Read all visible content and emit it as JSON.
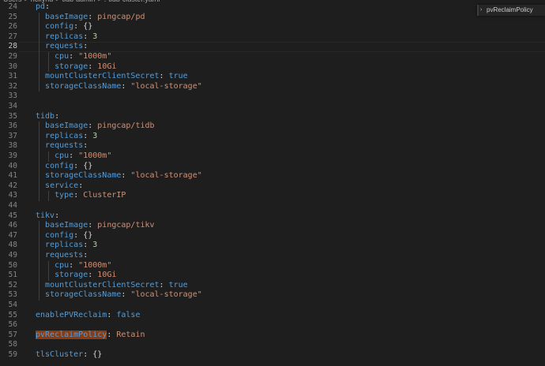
{
  "breadcrumb": [
    "Users",
    ">",
    "rickyhu",
    ">",
    "tidb-admin",
    ">",
    "!",
    "tidb-cluster.yaml"
  ],
  "find": {
    "value": "pvReclaimPolicy"
  },
  "lines": [
    {
      "n": "24",
      "tokens": [
        {
          "t": "pd",
          "c": "k"
        },
        {
          "t": ":",
          "c": "p"
        }
      ]
    },
    {
      "n": "25",
      "tokens": [
        {
          "t": "  "
        },
        {
          "t": "baseImage",
          "c": "k"
        },
        {
          "t": ": ",
          "c": "p"
        },
        {
          "t": "pingcap/pd",
          "c": "s"
        }
      ]
    },
    {
      "n": "26",
      "tokens": [
        {
          "t": "  "
        },
        {
          "t": "config",
          "c": "k"
        },
        {
          "t": ": ",
          "c": "p"
        },
        {
          "t": "{}",
          "c": "p"
        }
      ]
    },
    {
      "n": "27",
      "tokens": [
        {
          "t": "  "
        },
        {
          "t": "replicas",
          "c": "k"
        },
        {
          "t": ": ",
          "c": "p"
        },
        {
          "t": "3",
          "c": "n"
        }
      ]
    },
    {
      "n": "28",
      "tokens": [
        {
          "t": "  "
        },
        {
          "t": "requests",
          "c": "k"
        },
        {
          "t": ":",
          "c": "p"
        }
      ]
    },
    {
      "n": "29",
      "tokens": [
        {
          "t": "    "
        },
        {
          "t": "cpu",
          "c": "k"
        },
        {
          "t": ": ",
          "c": "p"
        },
        {
          "t": "\"1000m\"",
          "c": "s"
        }
      ]
    },
    {
      "n": "30",
      "tokens": [
        {
          "t": "    "
        },
        {
          "t": "storage",
          "c": "k"
        },
        {
          "t": ": ",
          "c": "p"
        },
        {
          "t": "10Gi",
          "c": "s"
        }
      ]
    },
    {
      "n": "31",
      "tokens": [
        {
          "t": "  "
        },
        {
          "t": "mountClusterClientSecret",
          "c": "k"
        },
        {
          "t": ": ",
          "c": "p"
        },
        {
          "t": "true",
          "c": "b"
        }
      ]
    },
    {
      "n": "32",
      "tokens": [
        {
          "t": "  "
        },
        {
          "t": "storageClassName",
          "c": "k"
        },
        {
          "t": ": ",
          "c": "p"
        },
        {
          "t": "\"local-storage\"",
          "c": "s"
        }
      ]
    },
    {
      "n": "33",
      "tokens": []
    },
    {
      "n": "34",
      "tokens": []
    },
    {
      "n": "35",
      "tokens": [
        {
          "t": "tidb",
          "c": "k"
        },
        {
          "t": ":",
          "c": "p"
        }
      ]
    },
    {
      "n": "36",
      "tokens": [
        {
          "t": "  "
        },
        {
          "t": "baseImage",
          "c": "k"
        },
        {
          "t": ": ",
          "c": "p"
        },
        {
          "t": "pingcap/tidb",
          "c": "s"
        }
      ]
    },
    {
      "n": "37",
      "tokens": [
        {
          "t": "  "
        },
        {
          "t": "replicas",
          "c": "k"
        },
        {
          "t": ": ",
          "c": "p"
        },
        {
          "t": "3",
          "c": "n"
        }
      ]
    },
    {
      "n": "38",
      "tokens": [
        {
          "t": "  "
        },
        {
          "t": "requests",
          "c": "k"
        },
        {
          "t": ":",
          "c": "p"
        }
      ]
    },
    {
      "n": "39",
      "tokens": [
        {
          "t": "    "
        },
        {
          "t": "cpu",
          "c": "k"
        },
        {
          "t": ": ",
          "c": "p"
        },
        {
          "t": "\"1000m\"",
          "c": "s"
        }
      ]
    },
    {
      "n": "40",
      "tokens": [
        {
          "t": "  "
        },
        {
          "t": "config",
          "c": "k"
        },
        {
          "t": ": ",
          "c": "p"
        },
        {
          "t": "{}",
          "c": "p"
        }
      ]
    },
    {
      "n": "41",
      "tokens": [
        {
          "t": "  "
        },
        {
          "t": "storageClassName",
          "c": "k"
        },
        {
          "t": ": ",
          "c": "p"
        },
        {
          "t": "\"local-storage\"",
          "c": "s"
        }
      ]
    },
    {
      "n": "42",
      "tokens": [
        {
          "t": "  "
        },
        {
          "t": "service",
          "c": "k"
        },
        {
          "t": ":",
          "c": "p"
        }
      ]
    },
    {
      "n": "43",
      "tokens": [
        {
          "t": "    "
        },
        {
          "t": "type",
          "c": "k"
        },
        {
          "t": ": ",
          "c": "p"
        },
        {
          "t": "ClusterIP",
          "c": "s"
        }
      ]
    },
    {
      "n": "44",
      "tokens": []
    },
    {
      "n": "45",
      "tokens": [
        {
          "t": "tikv",
          "c": "k"
        },
        {
          "t": ":",
          "c": "p"
        }
      ]
    },
    {
      "n": "46",
      "tokens": [
        {
          "t": "  "
        },
        {
          "t": "baseImage",
          "c": "k"
        },
        {
          "t": ": ",
          "c": "p"
        },
        {
          "t": "pingcap/tikv",
          "c": "s"
        }
      ]
    },
    {
      "n": "47",
      "tokens": [
        {
          "t": "  "
        },
        {
          "t": "config",
          "c": "k"
        },
        {
          "t": ": ",
          "c": "p"
        },
        {
          "t": "{}",
          "c": "p"
        }
      ]
    },
    {
      "n": "48",
      "tokens": [
        {
          "t": "  "
        },
        {
          "t": "replicas",
          "c": "k"
        },
        {
          "t": ": ",
          "c": "p"
        },
        {
          "t": "3",
          "c": "n"
        }
      ]
    },
    {
      "n": "49",
      "tokens": [
        {
          "t": "  "
        },
        {
          "t": "requests",
          "c": "k"
        },
        {
          "t": ":",
          "c": "p"
        }
      ]
    },
    {
      "n": "50",
      "tokens": [
        {
          "t": "    "
        },
        {
          "t": "cpu",
          "c": "k"
        },
        {
          "t": ": ",
          "c": "p"
        },
        {
          "t": "\"1000m\"",
          "c": "s"
        }
      ]
    },
    {
      "n": "51",
      "tokens": [
        {
          "t": "    "
        },
        {
          "t": "storage",
          "c": "k"
        },
        {
          "t": ": ",
          "c": "p"
        },
        {
          "t": "10Gi",
          "c": "s"
        }
      ]
    },
    {
      "n": "52",
      "tokens": [
        {
          "t": "  "
        },
        {
          "t": "mountClusterClientSecret",
          "c": "k"
        },
        {
          "t": ": ",
          "c": "p"
        },
        {
          "t": "true",
          "c": "b"
        }
      ]
    },
    {
      "n": "53",
      "tokens": [
        {
          "t": "  "
        },
        {
          "t": "storageClassName",
          "c": "k"
        },
        {
          "t": ": ",
          "c": "p"
        },
        {
          "t": "\"local-storage\"",
          "c": "s"
        }
      ]
    },
    {
      "n": "54",
      "tokens": []
    },
    {
      "n": "55",
      "tokens": [
        {
          "t": "enablePVReclaim",
          "c": "k"
        },
        {
          "t": ": ",
          "c": "p"
        },
        {
          "t": "false",
          "c": "b"
        }
      ]
    },
    {
      "n": "56",
      "tokens": []
    },
    {
      "n": "57",
      "tokens": [
        {
          "t": "pvReclaimPolicy",
          "c": "k",
          "hl": true
        },
        {
          "t": ": ",
          "c": "p"
        },
        {
          "t": "Retain",
          "c": "s"
        }
      ]
    },
    {
      "n": "58",
      "tokens": []
    },
    {
      "n": "59",
      "tokens": [
        {
          "t": "tlsCluster",
          "c": "k"
        },
        {
          "t": ": ",
          "c": "p"
        },
        {
          "t": "{}",
          "c": "p"
        }
      ]
    }
  ],
  "active_line": "28",
  "colors": {
    "background": "#1e1e1e",
    "key": "#569cd6",
    "string": "#ce9178",
    "number": "#b5cea8",
    "match_highlight": "#8a3b12"
  }
}
